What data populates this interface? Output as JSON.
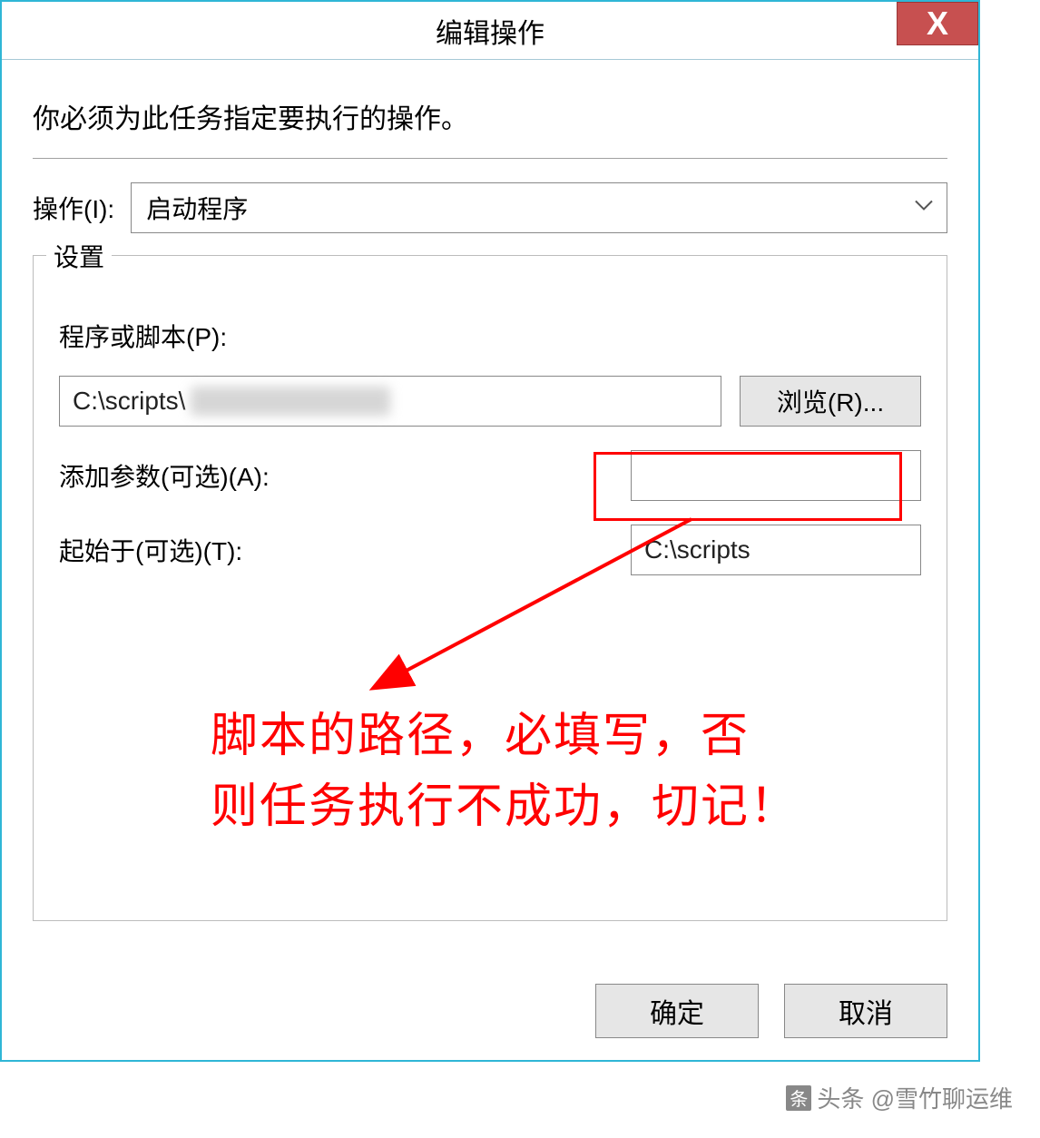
{
  "titlebar": {
    "title": "编辑操作",
    "close_label": "X"
  },
  "instruction": "你必须为此任务指定要执行的操作。",
  "action": {
    "label": "操作(I):",
    "selected": "启动程序"
  },
  "settings": {
    "legend": "设置",
    "program_label": "程序或脚本(P):",
    "program_value": "C:\\scripts\\",
    "browse_label": "浏览(R)...",
    "args_label": "添加参数(可选)(A):",
    "args_value": "",
    "startin_label": "起始于(可选)(T):",
    "startin_value": "C:\\scripts"
  },
  "annotation": {
    "line1": "脚本的路径，必填写，否",
    "line2": "则任务执行不成功，切记！"
  },
  "footer": {
    "ok": "确定",
    "cancel": "取消"
  },
  "watermark": "头条 @雪竹聊运维"
}
